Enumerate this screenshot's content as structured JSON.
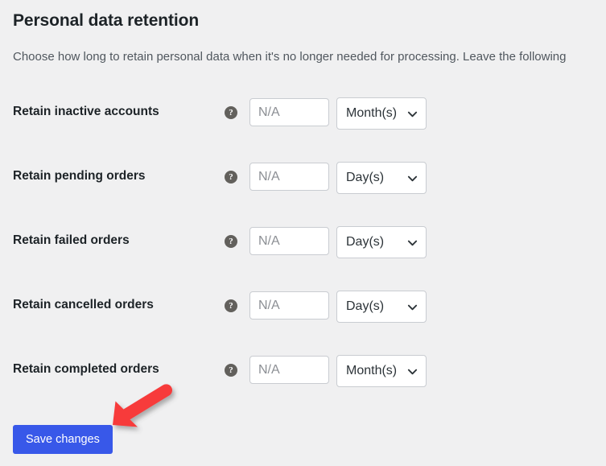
{
  "section": {
    "title": "Personal data retention",
    "description": "Choose how long to retain personal data when it's no longer needed for processing. Leave the following"
  },
  "help_icon_glyph": "?",
  "rows": [
    {
      "label": "Retain inactive accounts",
      "help_name": "help-tip-retain-inactive-accounts",
      "input_placeholder": "N/A",
      "input_value": "",
      "unit": "Month(s)"
    },
    {
      "label": "Retain pending orders",
      "help_name": "help-tip-retain-pending-orders",
      "input_placeholder": "N/A",
      "input_value": "",
      "unit": "Day(s)"
    },
    {
      "label": "Retain failed orders",
      "help_name": "help-tip-retain-failed-orders",
      "input_placeholder": "N/A",
      "input_value": "",
      "unit": "Day(s)"
    },
    {
      "label": "Retain cancelled orders",
      "help_name": "help-tip-retain-cancelled-orders",
      "input_placeholder": "N/A",
      "input_value": "",
      "unit": "Day(s)"
    },
    {
      "label": "Retain completed orders",
      "help_name": "help-tip-retain-completed-orders",
      "input_placeholder": "N/A",
      "input_value": "",
      "unit": "Month(s)"
    }
  ],
  "footer": {
    "save_label": "Save changes"
  },
  "colors": {
    "background": "#f0f0f1",
    "heading_text": "#1d2327",
    "body_text": "#50575e",
    "placeholder_text": "#8c8f94",
    "field_border": "#c9ccd1",
    "field_background": "#ffffff",
    "primary_button": "#3858e9",
    "help_icon": "#62605c",
    "annotation_arrow": "#f73b3b"
  }
}
